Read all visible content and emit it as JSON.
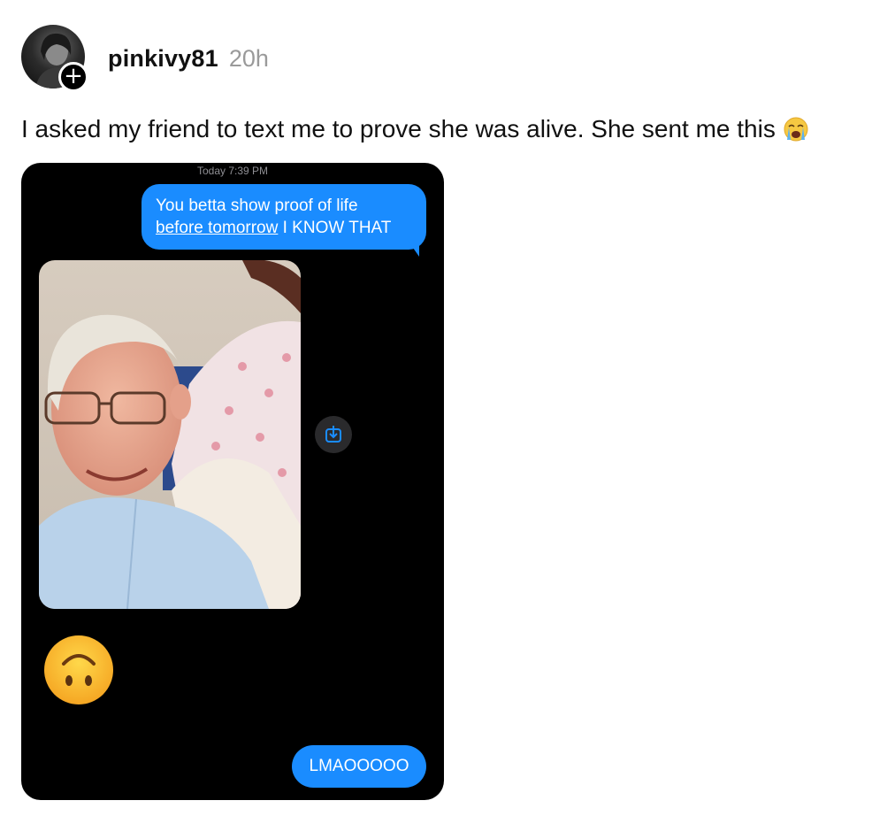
{
  "post": {
    "username": "pinkivy81",
    "time_ago": "20h",
    "follow_symbol": "+",
    "caption": "I asked my friend to text me to prove she was alive. She sent me this",
    "caption_emoji": "loudly-crying-face-emoji"
  },
  "screenshot": {
    "thread_time": "Today 7:39 PM",
    "outgoing_message_1": {
      "underlined_part": "before tomorrow",
      "line_1": "You betta show proof of life",
      "trailing_part": " I KNOW THAT"
    },
    "received_photo": "photo-of-smiling-older-man-in-light-blue-shirt",
    "save_icon": "download-to-photos-icon",
    "received_emoji": "upside-down-face-emoji",
    "outgoing_message_2": "LMAOOOOO",
    "colors": {
      "bubble_blue": "#1a8cff",
      "background": "#000000"
    }
  }
}
